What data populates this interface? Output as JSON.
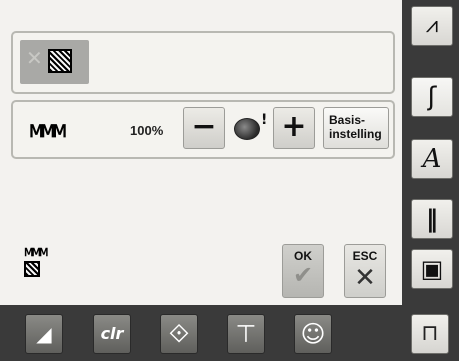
{
  "stitch_panel": {
    "selected_icon": "crosshatch-pattern-icon",
    "cross_mark": "✕"
  },
  "width_panel": {
    "stitch_icon": "zigzag-stitch-icon",
    "zigzag_glyph": "ⅯⅯⅯ",
    "value": "100%",
    "minus_label": "−",
    "plus_label": "+",
    "reset_icon": "rotate-reset-icon",
    "reset_mark": "!",
    "basis_line1": "Basis-",
    "basis_line2": "instelling"
  },
  "footer_icon": {
    "zigzag_glyph": "ⅯⅯⅯ"
  },
  "actions": {
    "ok_label": "OK",
    "ok_glyph": "✔",
    "esc_label": "ESC",
    "esc_glyph": "✕"
  },
  "side_toolbar": [
    {
      "name": "zigzag-vertical-icon",
      "glyph": "⩘"
    },
    {
      "name": "wave-stitch-icon",
      "glyph": "ʃ"
    },
    {
      "name": "italic-a-icon",
      "glyph": "A"
    },
    {
      "name": "vertical-bar-icon",
      "glyph": "‖"
    },
    {
      "name": "frame-square-icon",
      "glyph": "▣"
    }
  ],
  "bottom_toolbar": [
    {
      "name": "needle-position-icon",
      "glyph": "◢"
    },
    {
      "name": "clear-icon",
      "glyph": "clr"
    },
    {
      "name": "combi-mode-icon",
      "glyph": "⟐"
    },
    {
      "name": "text-frame-icon",
      "glyph": "⊤"
    },
    {
      "name": "smiley-icon",
      "glyph": "☺"
    },
    {
      "name": "machine-icon",
      "glyph": "⊓"
    }
  ]
}
